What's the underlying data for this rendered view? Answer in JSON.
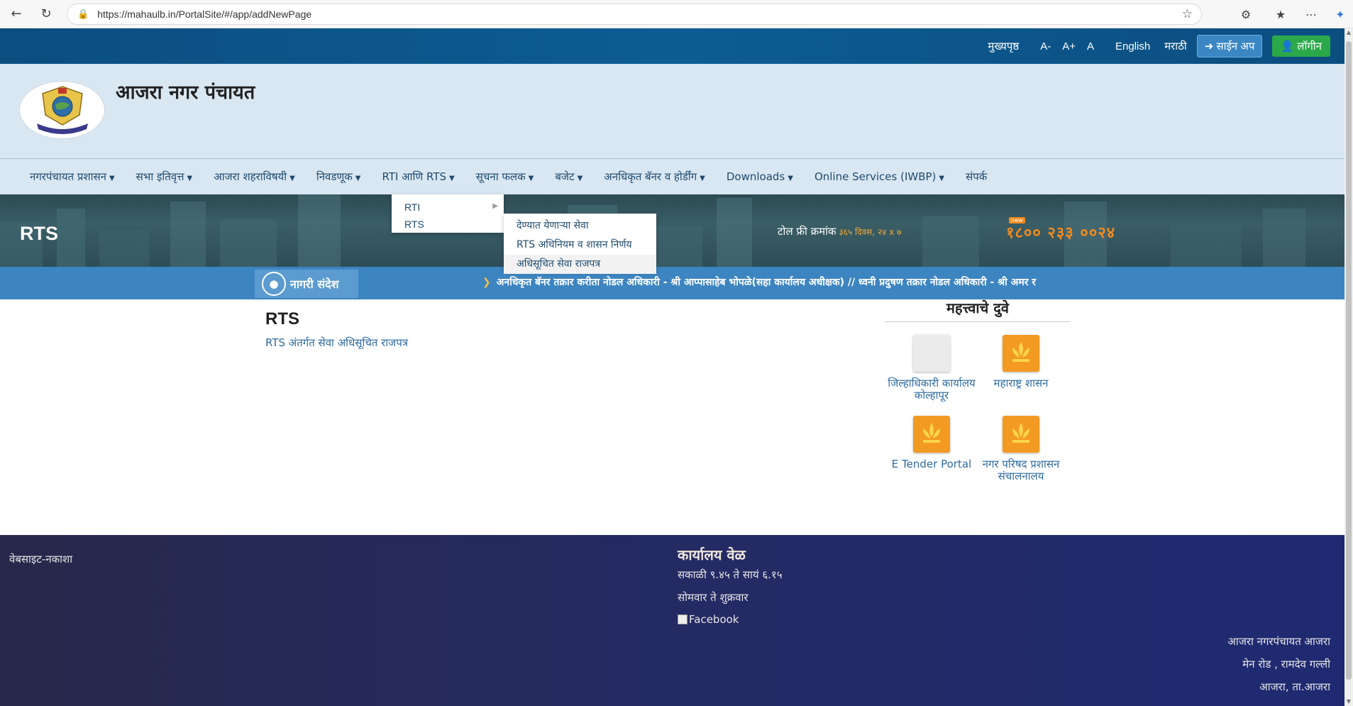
{
  "browser": {
    "url": "https://mahaulb.in/PortalSite/#/app/addNewPage"
  },
  "topbar": {
    "home": "मुख्यपृष्ठ",
    "font_minus": "A-",
    "font_plus": "A+",
    "font_normal": "A",
    "english": "English",
    "marathi": "मराठी",
    "signup": "साईन अप",
    "login": "लॉगीन"
  },
  "header": {
    "title": "आजरा नगर पंचायत"
  },
  "nav": {
    "items": [
      "नगरपंचायत प्रशासन",
      "सभा इतिवृत्त",
      "आजरा शहराविषयी",
      "निवडणूक",
      "RTI आणि RTS",
      "सूचना फलक",
      "बजेट",
      "अनधिकृत बॅनर व होर्डींग",
      "Downloads",
      "Online Services (IWBP)",
      "संपर्क"
    ]
  },
  "dropdown": {
    "level1": [
      "RTI",
      "RTS"
    ],
    "level2": [
      "देण्यात येणाऱ्या सेवा",
      "RTS अधिनियम व शासन निर्णय",
      "अधिसूचित सेवा राजपत्र"
    ]
  },
  "banner": {
    "page_name": "RTS",
    "tollfree_label": "टोल फ्री क्रमांक",
    "tollfree_hours": "३६५ दिवस, २४ x ७",
    "tollfree_number": "१८०० २३३ ००२४",
    "new_tag": "new"
  },
  "marquee": {
    "label": "नागरी संदेश",
    "text": "अनधिकृत बॅनर तक्रार करीता नोडल अधिकारी - श्री आप्पासाहेब भोपळे(सहा कार्यालय अधीक्षक) // ध्वनी प्रदुषण तक्रार नोडल अधिकारी - श्री अमर र"
  },
  "content": {
    "title": "RTS",
    "link": "RTS अंतर्गत सेवा अधिसूचित राजपत्र"
  },
  "important_links": {
    "title": "महत्त्वाचे दुवे",
    "tiles": [
      {
        "label": "जिल्हाधिकारी कार्यालय कोल्हापूर"
      },
      {
        "label": "महाराष्ट्र शासन"
      },
      {
        "label": "E Tender Portal"
      },
      {
        "label": "नगर परिषद प्रशासन संचालनालय"
      }
    ]
  },
  "footer": {
    "sitemap": "वेबसाइट-नकाशा",
    "office_hours_title": "कार्यालय वेळ",
    "office_hours_time": "सकाळी ९.४५ ते सायं ६.१५",
    "office_hours_days": "सोमवार ते शुक्रवार",
    "facebook": "Facebook",
    "address": [
      "आजरा नगरपंचायत आजरा",
      "मेन रोड , रामदेव गल्ली",
      "आजरा, ता.आजरा"
    ]
  },
  "colors": {
    "topbar": "#0b4e80",
    "header_bg": "#d9e7f2",
    "marquee_bg": "#3d85c0",
    "footer_bg": "#252a5f",
    "login_green": "#2aa84a",
    "tollfree_orange": "#f28a1e"
  }
}
